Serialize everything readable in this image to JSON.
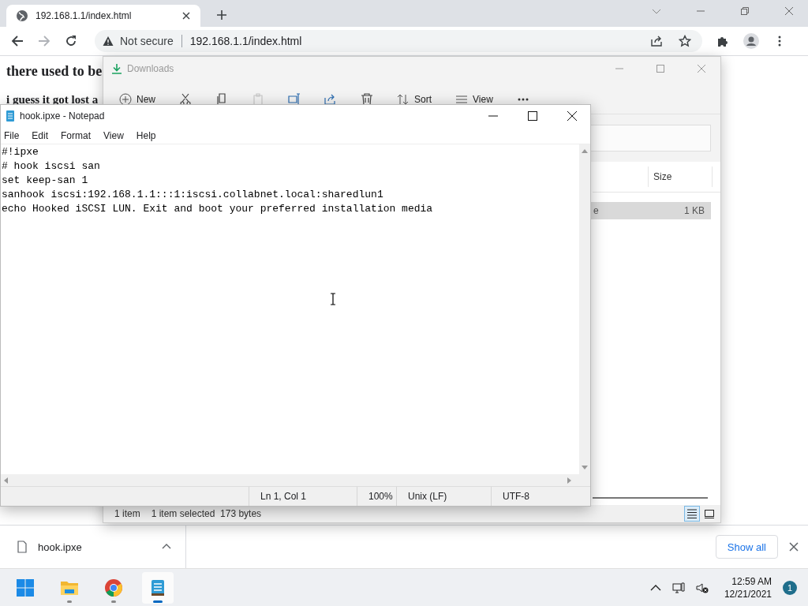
{
  "browser": {
    "tab": {
      "title": "192.168.1.1/index.html",
      "selected": true
    },
    "security": "Not secure",
    "url": "192.168.1.1/index.html"
  },
  "page": {
    "lines": [
      "there used to be",
      "i guess it got lost a"
    ]
  },
  "explorer": {
    "title": "Downloads",
    "toolbar": [
      {
        "kind": "new",
        "label": "New",
        "disabled": false
      },
      {
        "kind": "cut",
        "disabled": false
      },
      {
        "kind": "copy",
        "disabled": false
      },
      {
        "kind": "paste",
        "disabled": true
      },
      {
        "kind": "rename",
        "disabled": false
      },
      {
        "kind": "share",
        "disabled": false
      },
      {
        "kind": "delete",
        "disabled": false
      },
      {
        "kind": "sort",
        "label": "Sort",
        "disabled": false
      },
      {
        "kind": "view",
        "label": "View",
        "disabled": false
      },
      {
        "kind": "more",
        "disabled": false
      }
    ],
    "columns": [
      "Size"
    ],
    "rows": [
      {
        "name": "e",
        "size": "1 KB",
        "selected": true
      }
    ],
    "status": {
      "count": "1 item",
      "selection": "1 item selected  173 bytes"
    },
    "views": [
      {
        "kind": "details",
        "selected": true
      },
      {
        "kind": "tiles",
        "selected": false
      }
    ]
  },
  "notepad": {
    "title": "hook.ipxe - Notepad",
    "menu": [
      "File",
      "Edit",
      "Format",
      "View",
      "Help"
    ],
    "lines": [
      "#!ipxe",
      "# hook iscsi san",
      "set keep-san 1",
      "sanhook iscsi:192.168.1.1:::1:iscsi.collabnet.local:sharedlun1",
      "echo Hooked iSCSI LUN. Exit and boot your preferred installation media"
    ],
    "status": [
      "Ln 1, Col 1",
      "100%",
      "Unix (LF)",
      "UTF-8"
    ]
  },
  "downloads_bar": {
    "file": "hook.ipxe",
    "show_all": "Show all"
  },
  "taskbar": {
    "apps": [
      {
        "kind": "start",
        "running": false,
        "active": false
      },
      {
        "kind": "explorer",
        "running": true,
        "active": false
      },
      {
        "kind": "chrome",
        "running": true,
        "active": false
      },
      {
        "kind": "notepad",
        "running": true,
        "active": true
      }
    ],
    "time": "12:59 AM",
    "date": "12/21/2021",
    "notifications": "1"
  }
}
